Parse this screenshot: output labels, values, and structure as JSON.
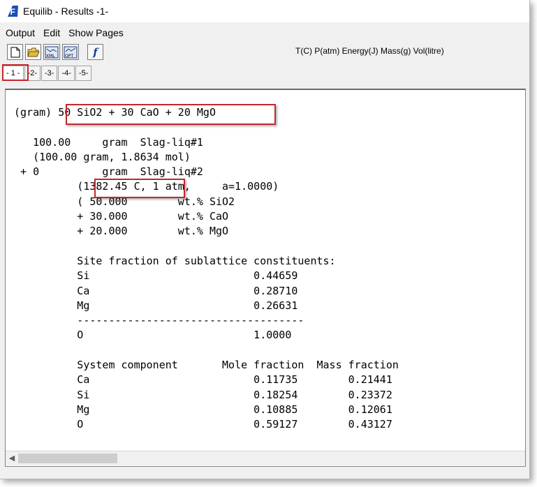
{
  "window": {
    "title": "Equilib - Results  -1-"
  },
  "menu": {
    "items": [
      "Output",
      "Edit",
      "Show Pages"
    ]
  },
  "toolbar": {
    "new_icon": "new-document-icon",
    "open_icon": "open-folder-icon",
    "xml_label": "XML",
    "opt_label": "OPT",
    "function_label": "f",
    "units": "T(C) P(atm) Energy(J) Mass(g) Vol(litre)"
  },
  "tabs": [
    "- 1 -",
    "-2-",
    "-3-",
    "-4-",
    "-5-"
  ],
  "output": {
    "reaction_prefix": "(gram) ",
    "reaction": "50 SiO2 + 30 CaO + 20 MgO",
    "line1": "   100.00     gram  Slag-liq#1",
    "line2": "   (100.00 gram, 1.8634 mol)",
    "line3": " + 0          gram  Slag-liq#2",
    "conditions_temp": "(1382.45 C,",
    "conditions_rest": " 1 atm,     a=1.0000)",
    "comp1": "          ( 50.000        wt.% SiO2",
    "comp2": "          + 30.000        wt.% CaO",
    "comp3": "          + 20.000        wt.% MgO",
    "site_header": "          Site fraction of sublattice constituents:",
    "site_si": "          Si                          0.44659",
    "site_ca": "          Ca                          0.28710",
    "site_mg": "          Mg                          0.26631",
    "separator": "          ------------------------------------",
    "site_o": "          O                           1.0000",
    "sys_header": "          System component       Mole fraction  Mass fraction",
    "sys_ca": "          Ca                          0.11735        0.21441",
    "sys_si": "          Si                          0.18254        0.23372",
    "sys_mg": "          Mg                          0.10885        0.12061",
    "sys_o": "          O                           0.59127        0.43127"
  },
  "colors": {
    "highlight": "#c0282d",
    "app_icon": "#1b4fb5"
  }
}
